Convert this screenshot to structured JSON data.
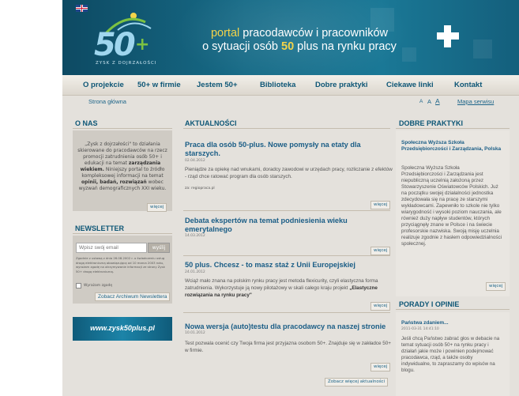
{
  "header": {
    "logo_text": "ZYSK Z DOJRZAŁOŚCI",
    "tagline_portal": "portal",
    "tagline_rest1": " pracodawców i pracowników",
    "tagline_pre2": "o sytuacji osób ",
    "tagline_num": "50",
    "tagline_post2": " plus na rynku pracy"
  },
  "nav": {
    "items": [
      "O projekcie",
      "50+ w firmie",
      "Jestem 50+",
      "Biblioteka",
      "Dobre praktyki",
      "Ciekawe linki",
      "Kontakt"
    ]
  },
  "subbar": {
    "home": "Strona główna",
    "font_small": "A",
    "font_medium": "A",
    "font_large": "A",
    "sitemap": "Mapa serwisu"
  },
  "left": {
    "onas_heading": "O NAS",
    "onas_p1": "„Zysk z dojrzałości\" to działania skierowane do pracodawców na rzecz promocji zatrudnienia osób 50+ i edukacji na temat ",
    "onas_b1": "zarządzania wiekiem.",
    "onas_p2": " Niniejszy portal to źródło kompleksowej informacji na temat ",
    "onas_b2": "opinii, badań, rozwiązań",
    "onas_p3": " wobec wyzwań demograficznych XXI wieku.",
    "onas_more": "więcej",
    "newsletter_heading": "NEWSLETTER",
    "email_placeholder": "Wpisz swój email",
    "go_label": "wyślij",
    "consent_text": "Zgodnie z ustawą z dnia 26.08.2002 r. o świadczeniu usług drogą elektroniczną obowiązującą od 10 marca 2003 roku, wyrażam zgodę na otrzymywanie informacji ze strony Zysk 50+ drogą elektroniczną.",
    "consent_label": "Wyrażam zgodę",
    "archive_label": "Zobacz Archiwum Newslettera",
    "banner_text": "www.zysk50plus.pl"
  },
  "middle": {
    "heading": "AKTUALNOŚCI",
    "articles": [
      {
        "title": "Praca dla osób 50-plus. Nowe pomysły na etaty dla starszych.",
        "date": "02.04.2012",
        "body": "Pieniądze za opiekę nad wnukami, doradcy zawodowi w urzędach pracy, rozliczanie z efektów - rząd chce ratować program dla osób starszych.",
        "source": "za: regiopraca.pl",
        "more": "więcej"
      },
      {
        "title": "Debata ekspertów na temat podniesienia wieku emerytalnego",
        "date": "14.03.2012",
        "more": "więcej"
      },
      {
        "title": "50 plus. Chcesz - to masz staż z Unii Europejskiej",
        "date": "24.01.2012",
        "body_a": "Wciąż mało znana na polskim rynku pracy jest metoda flexicurity, czyli elastyczna forma zatrudnienia. Wykorzystuje ją nowy pilotażowy w skali całego kraju projekt ",
        "body_b": "„Elastyczne rozwiązania na rynku pracy\"",
        "more": "więcej"
      },
      {
        "title": "Nowa wersja (auto)testu dla pracodawcy na naszej stronie",
        "date": "10.01.2012",
        "body": "Test pozwala ocenić czy Twoja firma jest przyjazna osobom 50+. Znajduje się w zakładce 50+ w firmie.",
        "more": "więcej"
      }
    ],
    "more_news": "Zobacz więcej aktualności"
  },
  "right": {
    "heading": "DOBRE PRAKTYKI",
    "box_title": "Społeczna Wyższa Szkoła Przedsiębiorczości i Zarządzania, Polska",
    "box_body": "Społeczna Wyższa Szkoła Przedsiębiorczości i Zarządzania jest niepubliczną uczelnią założoną przez Stowarzyszenie Oświatowców Polskich. Już na początku swojej działalności jednostka zdecydowała się na pracę ze starszymi wykładowcami. Zapewniło to szkole nie tylko wiarygodność i wysoki poziom nauczania, ale również duży napływ studentów, których przyciągnęły znane w Polsce i na świecie profesorskie nazwiska. Swoją misję uczelnia realizuje zgodnie z hasłem odpowiedzialności społecznej.",
    "box_more": "więcej",
    "heading2": "PORADY I OPINIE",
    "box2_title": "Państwa zdaniem...",
    "box2_date": "2011-03-31 14:41:10",
    "box2_body": "Jeśli chcą Państwo zabrać głos w debacie na temat sytuacji osób 50+ na rynku pracy i działań jakie może i powinien podejmować pracodawca, rząd, a także osoby indywidualne, to zapraszamy do wpisów na blogu."
  },
  "colors": {
    "header_bg": "#176b87",
    "accent_yellow": "#f3d34a",
    "link_blue": "#1a5d86",
    "frame_bg": "#e4e1dc"
  }
}
